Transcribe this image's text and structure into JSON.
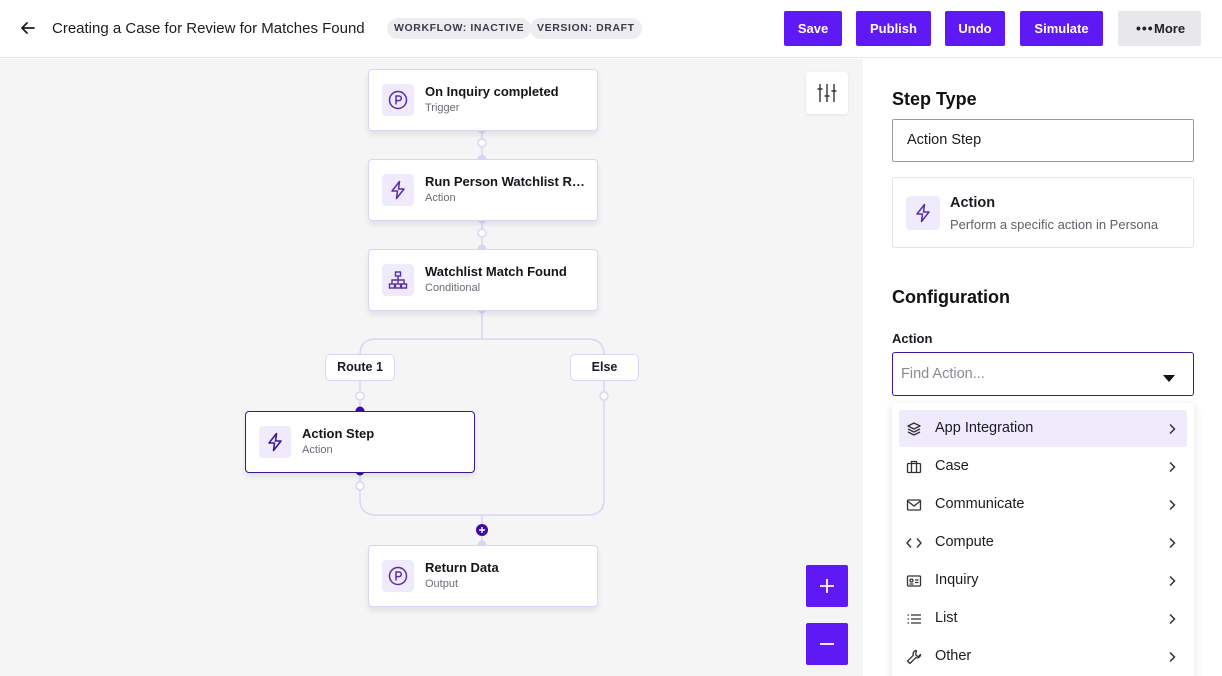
{
  "header": {
    "title": "Creating a Case for Review for Matches Found",
    "badges": {
      "workflow": "WORKFLOW: INACTIVE",
      "version": "VERSION: DRAFT"
    },
    "buttons": {
      "save": "Save",
      "publish": "Publish",
      "undo": "Undo",
      "simulate": "Simulate",
      "more": "More"
    }
  },
  "canvas": {
    "nodes": {
      "trigger": {
        "title": "On Inquiry completed",
        "subtitle": "Trigger"
      },
      "watchlist_report": {
        "title": "Run Person Watchlist Re...",
        "subtitle": "Action"
      },
      "conditional": {
        "title": "Watchlist Match Found",
        "subtitle": "Conditional"
      },
      "action_step": {
        "title": "Action Step",
        "subtitle": "Action"
      },
      "return_data": {
        "title": "Return Data",
        "subtitle": "Output"
      }
    },
    "routes": {
      "route1": "Route 1",
      "else": "Else"
    }
  },
  "panel": {
    "step_type_heading": "Step Type",
    "step_type_value": "Action Step",
    "card": {
      "title": "Action",
      "subtitle": "Perform a specific action in Persona"
    },
    "configuration_heading": "Configuration",
    "action_label": "Action",
    "action_placeholder": "Find Action...",
    "menu": [
      {
        "label": "App Integration",
        "icon": "layers-icon"
      },
      {
        "label": "Case",
        "icon": "briefcase-icon"
      },
      {
        "label": "Communicate",
        "icon": "mail-icon"
      },
      {
        "label": "Compute",
        "icon": "code-icon"
      },
      {
        "label": "Inquiry",
        "icon": "id-card-icon"
      },
      {
        "label": "List",
        "icon": "list-icon"
      },
      {
        "label": "Other",
        "icon": "wrench-icon"
      }
    ]
  },
  "colors": {
    "accent": "#5f19f5",
    "selected_border": "#3b1799",
    "icon_bg": "#efeafc",
    "wire": "#dcd3f7"
  }
}
